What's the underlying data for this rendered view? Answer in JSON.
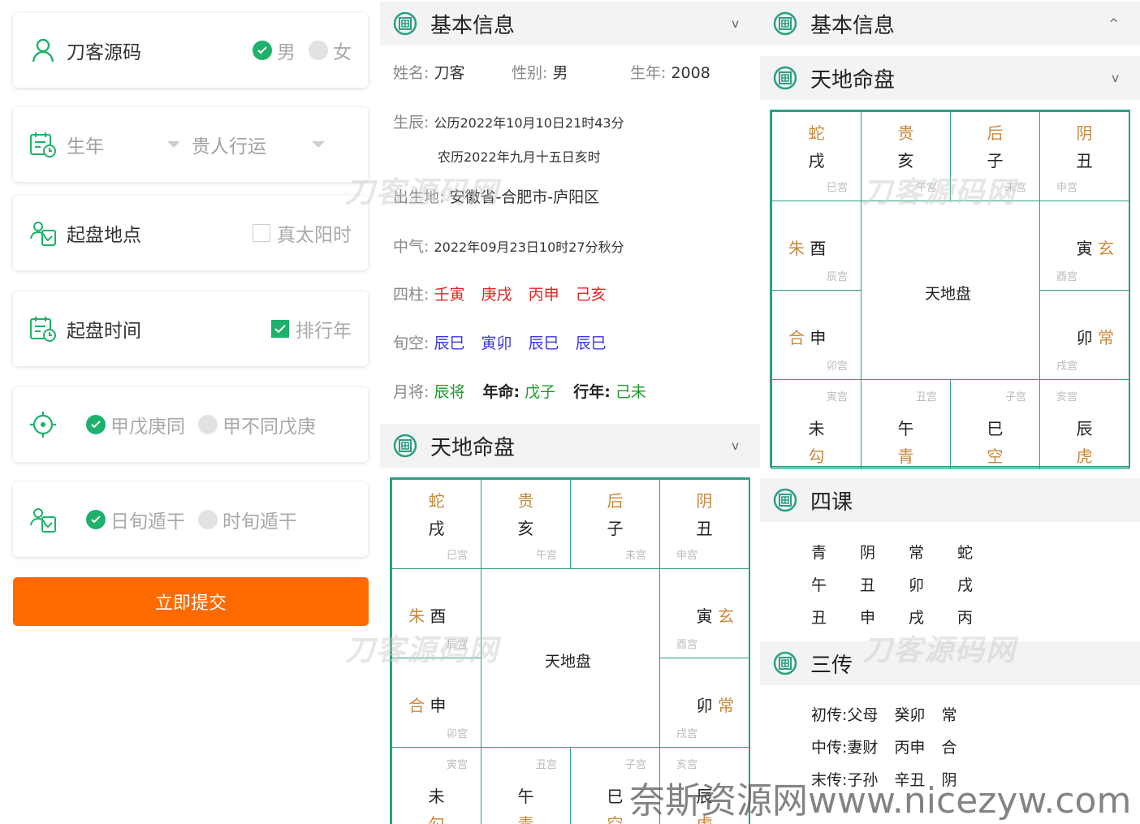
{
  "form": {
    "name_value": "刀客源码",
    "gender_male": "男",
    "gender_female": "女",
    "birth_year_placeholder": "生年",
    "fortune_placeholder": "贵人行运",
    "place_label": "起盘地点",
    "solar_time_label": "真太阳时",
    "time_label": "起盘时间",
    "year_label": "排行年",
    "rule1_opt1": "甲戊庚同",
    "rule1_opt2": "甲不同戊庚",
    "rule2_opt1": "日旬遁干",
    "rule2_opt2": "时旬遁干",
    "submit_label": "立即提交"
  },
  "sections": {
    "basic_info": "基本信息",
    "board": "天地命盘",
    "four_lessons": "四课",
    "three_trans": "三传",
    "chev_down": "v",
    "chev_up": "^"
  },
  "info": {
    "name_key": "姓名:",
    "name_val": "刀客",
    "gender_key": "性别:",
    "gender_val": "男",
    "year_key": "生年:",
    "year_val": "2008",
    "time_key": "生辰:",
    "solar": "公历2022年10月10日21时43分",
    "lunar": "农历2022年九月十五日亥时",
    "place_key": "出生地:",
    "place_val": "安徽省-合肥市-庐阳区",
    "qi_key": "中气:",
    "qi_val": "2022年09月23日10时27分秋分",
    "pillars_key": "四柱:",
    "pillars": [
      "壬寅",
      "庚戌",
      "丙申",
      "己亥"
    ],
    "xunkong_key": "旬空:",
    "xunkong": [
      "辰巳",
      "寅卯",
      "辰巳",
      "辰巳"
    ],
    "yuejiang_key": "月将:",
    "yuejiang_val": "辰将",
    "nianming_key": "年命:",
    "nianming_val": "戊子",
    "xingnian_key": "行年:",
    "xingnian_val": "己未"
  },
  "board": {
    "center": "天地盘",
    "top": [
      {
        "god": "蛇",
        "branch": "戌",
        "gong": "巳宫"
      },
      {
        "god": "贵",
        "branch": "亥",
        "gong": "午宫"
      },
      {
        "god": "后",
        "branch": "子",
        "gong": "未宫"
      },
      {
        "god": "阴",
        "branch": "丑",
        "gong": "申宫"
      }
    ],
    "left": [
      {
        "god": "朱",
        "branch": "酉",
        "gong": "辰宫"
      },
      {
        "god": "合",
        "branch": "申",
        "gong": "卯宫"
      }
    ],
    "right": [
      {
        "god": "玄",
        "branch": "寅",
        "gong": "酉宫"
      },
      {
        "god": "常",
        "branch": "卯",
        "gong": "戌宫"
      }
    ],
    "bottom": [
      {
        "gong": "寅宫",
        "branch": "未",
        "god": "勾"
      },
      {
        "gong": "丑宫",
        "branch": "午",
        "god": "青"
      },
      {
        "gong": "子宫",
        "branch": "巳",
        "god": "空"
      },
      {
        "gong": "亥宫",
        "branch": "辰",
        "god": "虎"
      }
    ]
  },
  "four_lessons": {
    "rows": [
      [
        "青",
        "阴",
        "常",
        "蛇"
      ],
      [
        "午",
        "丑",
        "卯",
        "戌"
      ],
      [
        "丑",
        "申",
        "戌",
        "丙"
      ]
    ]
  },
  "three_trans": {
    "rows": [
      {
        "key": "初传:",
        "rel": "父母",
        "gz": "癸卯",
        "god": "常"
      },
      {
        "key": "中传:",
        "rel": "妻财",
        "gz": "丙申",
        "god": "合"
      },
      {
        "key": "末传:",
        "rel": "子孙",
        "gz": "辛丑",
        "god": "阴"
      }
    ]
  },
  "watermarks": {
    "brand": "刀客源码网",
    "site": "奈斯资源网www.nicezyw.com"
  },
  "colors": {
    "accent_green": "#1db26b",
    "board_teal": "#2aa084",
    "submit_orange": "#ff6a00",
    "god_brown": "#c8883a",
    "pillar_red": "#e42525",
    "xunkong_blue": "#3a36e0",
    "yuejiang_green": "#1b9a2b"
  }
}
